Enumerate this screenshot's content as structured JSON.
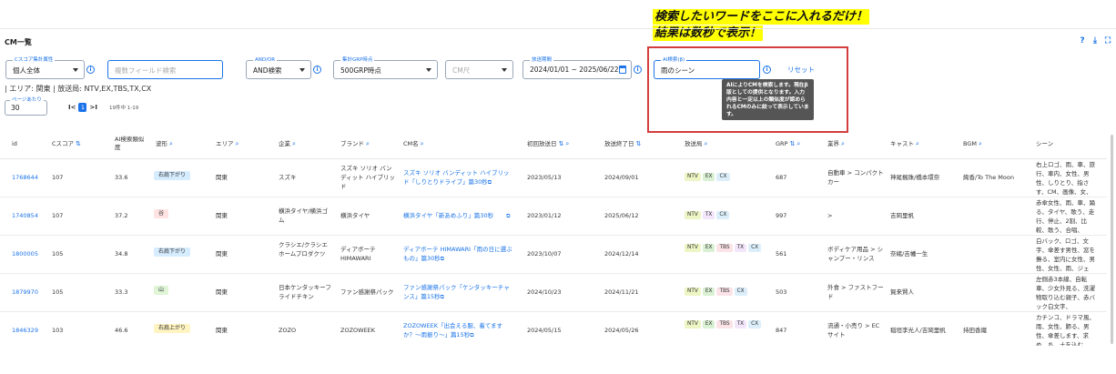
{
  "annotation": {
    "line1": "検索したいワードをここに入れるだけ！",
    "line2": "結果は数秒で表示！"
  },
  "page": {
    "title": "CM一覧",
    "header_icons": [
      "help-icon",
      "download-icon",
      "fullscreen-icon"
    ]
  },
  "filters": {
    "score_attr": {
      "label": "Cスコア集計属性",
      "value": "個人全体"
    },
    "multi_field": {
      "placeholder": "複数フィールド検索"
    },
    "and_or": {
      "label": "AND/OR",
      "value": "AND検索"
    },
    "grp": {
      "label": "集計GRP時点",
      "value": "500GRP時点"
    },
    "cm_length": {
      "placeholder": "CM尺"
    },
    "period": {
      "label": "放送期間",
      "value": "2024/01/01 ~ 2025/06/22"
    },
    "ai_search": {
      "label": "AI検索(β)",
      "value": "雨のシーン"
    },
    "reset_label": "リセット",
    "tooltip": "AIによりCMを検索します。現在β版としての提供となります。入力内容と一定以上の類似度が認められるCMのみに絞って表示しています。"
  },
  "area_text": "| エリア: 関東 | 放送局: NTV,EX,TBS,TX,CX",
  "pagination": {
    "per_page_label": "ページあたり",
    "per_page_value": "30",
    "first": "I<",
    "current": "1",
    "last": ">I",
    "count_text": "19件中 1-19"
  },
  "table": {
    "headers": {
      "id": "id",
      "cscore": "Cスコア",
      "ai_score": "AI検索類似度",
      "wave": "波形",
      "area": "エリア",
      "company": "企業",
      "brand": "ブランド",
      "cm_name": "CM名",
      "first_air": "初回放送日",
      "last_air": "放送終了日",
      "stations": "放送局",
      "grp": "GRP",
      "industry": "業界",
      "cast": "キャスト",
      "bgm": "BGM",
      "scene": "シーン"
    },
    "rows": [
      {
        "id": "1768644",
        "cscore": "107",
        "ai": "33.6",
        "wave": "右肩下がり",
        "wave_color": "#d6ecff",
        "area": "関東",
        "company": "スズキ",
        "brand": "スズキ ソリオ バンディット ハイブリッド",
        "cm": "スズキ ソリオ バンディット ハイブリッド「しりとりドライブ」篇30秒",
        "first": "2023/05/13",
        "last": "2024/09/01",
        "stations": [
          "NTV",
          "EX",
          "CX"
        ],
        "grp": "687",
        "industry": "自動車 > コンパクトカー",
        "cast": "神尾楓珠/橋本環奈",
        "bgm": "絢香/To The Moon",
        "scene": "右上ロゴ、雨、車、旅行、車内、女性、男性、しりとり、指さす、CM、画像、女、男"
      },
      {
        "id": "1740854",
        "cscore": "107",
        "ai": "37.2",
        "wave": "谷",
        "wave_color": "#ffe3e3",
        "area": "関東",
        "company": "横浜タイヤ/横浜ゴム",
        "brand": "横浜タイヤ",
        "cm": "横浜タイヤ「新あめふり」篇30秒",
        "first": "2023/01/12",
        "last": "2025/06/12",
        "stations": [
          "NTV",
          "TX",
          "CX"
        ],
        "grp": "997",
        "industry": ">",
        "cast": "吉岡里帆",
        "bgm": "",
        "scene": "赤傘女性、雨、車、踊る、タイヤ、歌う、走行、停止、2割、比較、歌う、合唱、"
      },
      {
        "id": "1800005",
        "cscore": "105",
        "ai": "34.8",
        "wave": "右肩下がり",
        "wave_color": "#d6ecff",
        "area": "関東",
        "company": "クラシエ/クラシエホームプロダクツ",
        "brand": "ディアボーテ HIMAWARI",
        "cm": "ディアボーテ HIMAWARI「雨の日に選ぶもの」篇30秒",
        "first": "2023/10/07",
        "last": "2024/12/14",
        "stations": [
          "NTV",
          "EX",
          "TBS",
          "TX",
          "CX"
        ],
        "grp": "561",
        "industry": "ボディケア用品 > シャンプー・リンス",
        "cast": "奈緒/吉幡一生",
        "bgm": "",
        "scene": "白バック、ロゴ、文字、傘差す男性、窓を撫る、室内に女性、男性、女性、雨、ジェル、"
      },
      {
        "id": "1879970",
        "cscore": "105",
        "ai": "33.3",
        "wave": "山",
        "wave_color": "#dff5d6",
        "area": "関東",
        "company": "日本ケンタッキーフライドチキン",
        "brand": "ファン感謝祭パック",
        "cm": "ファン感謝祭パック「ケンタッキーチャンス」篇15秒",
        "first": "2024/10/23",
        "last": "2024/11/21",
        "stations": [
          "NTV",
          "EX",
          "TBS",
          "CX"
        ],
        "grp": "503",
        "industry": "外食 > ファストフード",
        "cast": "賀来賢人",
        "bgm": "",
        "scene": "左側赤3本線、自転車、少女外見る、洗濯物取り込む親子、赤バック白文字、"
      },
      {
        "id": "1846329",
        "cscore": "103",
        "ai": "46.6",
        "wave": "右肩上がり",
        "wave_color": "#fff4c2",
        "area": "関東",
        "company": "ZOZO",
        "brand": "ZOZOWEEK",
        "cm": "ZOZOWEEK「出会える服、着てますか？〜雨振り〜」篇15秒",
        "first": "2024/05/15",
        "last": "2024/05/26",
        "stations": [
          "NTV",
          "EX",
          "TBS",
          "TX",
          "CX"
        ],
        "grp": "847",
        "industry": "流通・小売り > ECサイト",
        "cast": "稲垣李光人/吉岡里帆",
        "bgm": "持田香織",
        "scene": "カチンコ、ドラマ風、雨、女性、肺る、男性、傘差します、求め、ち、土を込む、"
      }
    ]
  },
  "colors": {
    "accent": "#1a73e8",
    "red_box": "#d43d3d",
    "tag_ntv": "#eef5c4",
    "tag_ex": "#d9f0d3",
    "tag_tbs": "#fbe3e8",
    "tag_tx": "#f3e6fb",
    "tag_cx": "#dbeefa"
  }
}
